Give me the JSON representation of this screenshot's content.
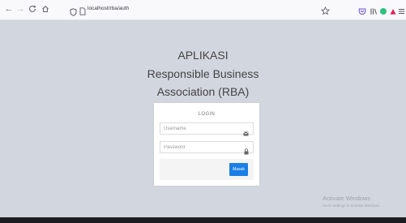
{
  "browser": {
    "url": "localhost/rba/auth",
    "icons": {
      "back": "arrow-left-icon",
      "forward": "arrow-right-icon",
      "reload": "reload-icon",
      "home": "home-icon",
      "tracking": "shield-icon",
      "page": "page-icon",
      "bookmark": "star-icon",
      "pocket": "pocket-icon",
      "library": "library-icon",
      "extension": "extension-icon",
      "account": "account-icon",
      "menu": "hamburger-menu-icon"
    }
  },
  "header": {
    "line1": "APLIKASI",
    "line2": "Responsible Business",
    "line3": "Association (RBA)"
  },
  "login": {
    "message": "LOGIN",
    "username_placeholder": "Username",
    "username_value": "",
    "password_placeholder": "Password",
    "password_value": "",
    "submit_label": "Masuk"
  },
  "watermark": {
    "title": "Activate Windows",
    "subtitle": "Go to Settings to activate Windows."
  },
  "colors": {
    "background": "#d2d6de",
    "primary_button": "#1a7fe6",
    "extension_green": "#2ec27e",
    "account_red": "#e0245e"
  }
}
